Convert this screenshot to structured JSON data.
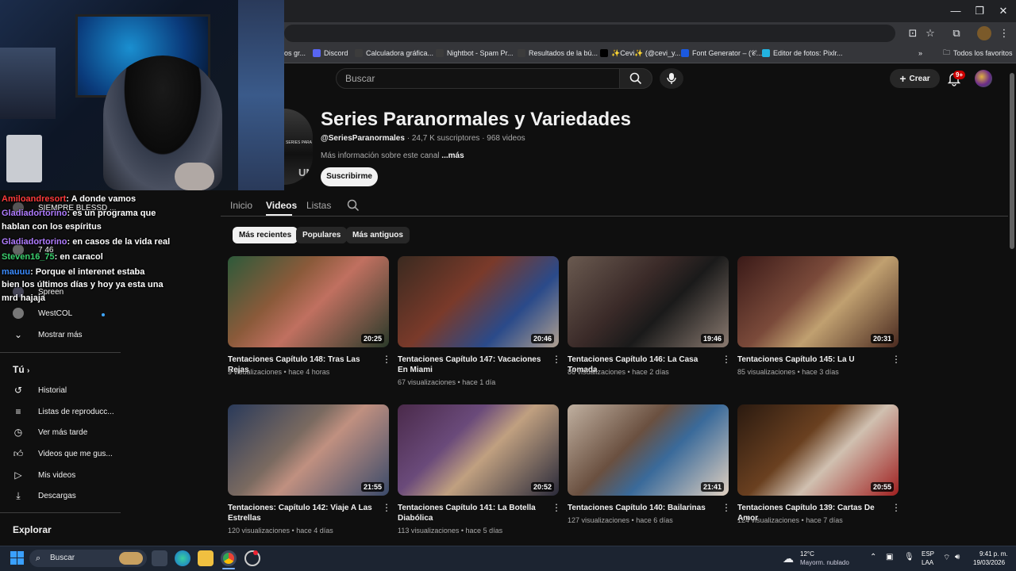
{
  "browser": {
    "bookmarks": [
      {
        "label": "Discord",
        "icon": "discord-icon",
        "color": "#5865f2"
      },
      {
        "label": "Calculadora gráfica...",
        "icon": "calculator-icon",
        "color": "#3c3c3c"
      },
      {
        "label": "Nightbot - Spam Pr...",
        "icon": "nightbot-icon",
        "color": "#3c3c3c"
      },
      {
        "label": "Resultados de la bú...",
        "icon": "document-icon",
        "color": "#3c3c3c"
      },
      {
        "label": "✨Cevi✨ (@cevi_y...",
        "icon": "tiktok-icon",
        "color": "#000000"
      },
      {
        "label": "Font Generator – (𝒞...",
        "icon": "font-icon",
        "color": "#1b59e0"
      },
      {
        "label": "Editor de fotos: Pixlr...",
        "icon": "pixlr-icon",
        "color": "#22b3e0"
      }
    ],
    "bookmark_partial": "os gr...",
    "all_bookmarks": "Todos los favoritos"
  },
  "youtube": {
    "search_placeholder": "Buscar",
    "create_label": "Crear",
    "notification_badge": "9+",
    "channel": {
      "title": "Series Paranormales y Variedades",
      "handle": "@SeriesParanormales",
      "meta": " · 24,7 K suscriptores · 968 videos",
      "description": "Más información sobre este canal ",
      "more": "...más",
      "subscribe": "Suscribirme"
    },
    "tabs": [
      "Inicio",
      "Videos",
      "Listas"
    ],
    "chips": [
      "Más recientes",
      "Populares",
      "Más antiguos"
    ],
    "videos": [
      {
        "title": "Tentaciones Capítulo 148: Tras Las Rejas",
        "views": "9 visualizaciones",
        "age": "hace 4 horas",
        "duration": "20:25"
      },
      {
        "title": "Tentaciones Capítulo 147: Vacaciones En Miami",
        "views": "67 visualizaciones",
        "age": "hace 1 día",
        "duration": "20:46"
      },
      {
        "title": "Tentaciones Capítulo 146: La Casa Tomada",
        "views": "86 visualizaciones",
        "age": "hace 2 días",
        "duration": "19:46"
      },
      {
        "title": "Tentaciones Capítulo 145: La U",
        "views": "85 visualizaciones",
        "age": "hace 3 días",
        "duration": "20:31"
      },
      {
        "title": "Tentaciones: Capítulo 142: Viaje A Las Estrellas",
        "views": "120 visualizaciones",
        "age": "hace 4 días",
        "duration": "21:55"
      },
      {
        "title": "Tentaciones Capítulo 141: La Botella Diabólica",
        "views": "113 visualizaciones",
        "age": "hace 5 días",
        "duration": "20:52"
      },
      {
        "title": "Tentaciones Capítulo 140: Bailarinas",
        "views": "127 visualizaciones",
        "age": "hace 6 días",
        "duration": "21:41"
      },
      {
        "title": "Tentaciones Capítulo 139: Cartas De Amor",
        "views": "124 visualizaciones",
        "age": "hace 7 días",
        "duration": "20:55"
      }
    ]
  },
  "sidebar": {
    "subscriptions": [
      {
        "label": "SIEMPRE BLESSD ..."
      },
      {
        "label": "7 46"
      },
      {
        "label": "Spreen"
      },
      {
        "label": "WestCOL"
      }
    ],
    "show_more": "Mostrar más",
    "you_heading": "Tú",
    "you_items": [
      {
        "label": "Historial",
        "icon": "history-icon"
      },
      {
        "label": "Listas de reproducc...",
        "icon": "playlists-icon"
      },
      {
        "label": "Ver más tarde",
        "icon": "watch-later-icon"
      },
      {
        "label": "Videos que me gus...",
        "icon": "like-icon"
      },
      {
        "label": "Mis videos",
        "icon": "my-videos-icon"
      },
      {
        "label": "Descargas",
        "icon": "download-icon"
      }
    ],
    "explore_heading": "Explorar"
  },
  "chat": [
    {
      "user": "Amiloandresort",
      "color": "#ff3b3b",
      "message": ": A donde vamos"
    },
    {
      "user": "Gladiadortorino",
      "color": "#b07cff",
      "message": ": es un programa que"
    },
    {
      "user": "",
      "color": "#ffffff",
      "message": "hablan con los espíritus"
    },
    {
      "user": "Gladiadortorino",
      "color": "#b07cff",
      "message": ": en casos de la vida real"
    },
    {
      "user": "Steven16_75",
      "color": "#3bd16f",
      "message": ": en caracol"
    },
    {
      "user": "mauuu",
      "color": "#3b8cff",
      "message": ": Porque el interenet estaba"
    },
    {
      "user": "",
      "color": "#ffffff",
      "message": "bien los últimos días y hoy ya esta una"
    },
    {
      "user": "",
      "color": "#ffffff",
      "message": "mrd hajaja"
    }
  ],
  "taskbar": {
    "search": "Buscar",
    "weather_temp": "12°C",
    "weather_desc": "Mayorm. nublado",
    "lang": "ESP",
    "lang_sub": "LAA",
    "time": "9:41 p. m.",
    "date": "19/03/2026"
  }
}
